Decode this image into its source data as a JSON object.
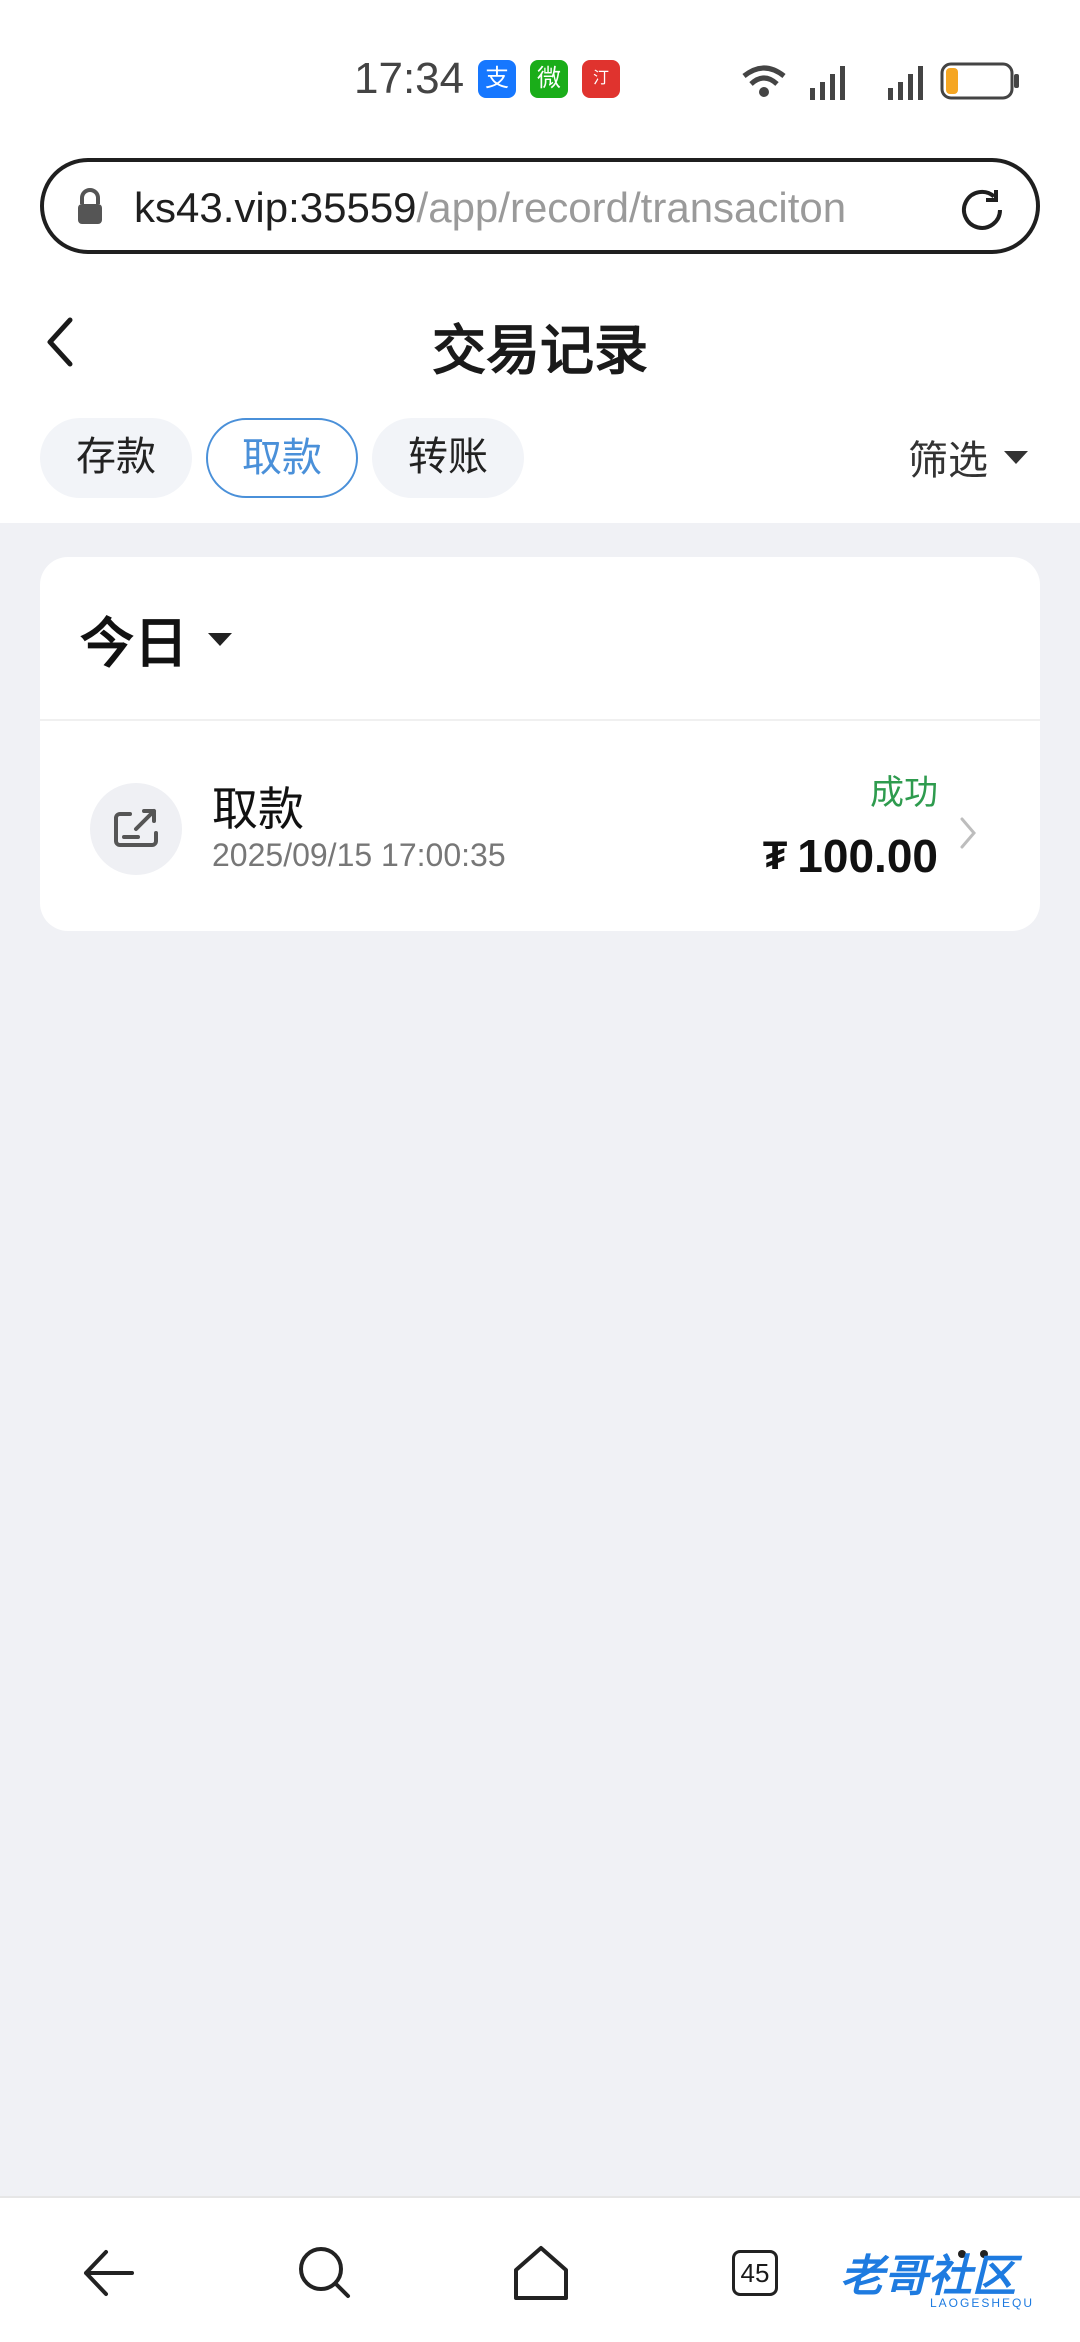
{
  "status_bar": {
    "time": "17:34",
    "apps": [
      "支",
      "微",
      "汀"
    ],
    "battery": "14"
  },
  "url_bar": {
    "host": "ks43.vip:35559",
    "path": "/app/record/transaciton"
  },
  "header": {
    "title": "交易记录"
  },
  "tabs": [
    {
      "label": "存款",
      "active": false
    },
    {
      "label": "取款",
      "active": true
    },
    {
      "label": "转账",
      "active": false
    }
  ],
  "filter_label": "筛选",
  "section": {
    "day_label": "今日"
  },
  "transactions": [
    {
      "title": "取款",
      "time": "2025/09/15 17:00:35",
      "status": "成功",
      "currency": "₮",
      "amount": "100.00"
    }
  ],
  "bottom_nav": {
    "tab_count": "45"
  },
  "watermark": {
    "text": "老哥社区",
    "sub": "LAOGESHEQU"
  },
  "colors": {
    "accent": "#4A90D9",
    "success": "#2E9B4E",
    "background": "#F0F1F5"
  }
}
